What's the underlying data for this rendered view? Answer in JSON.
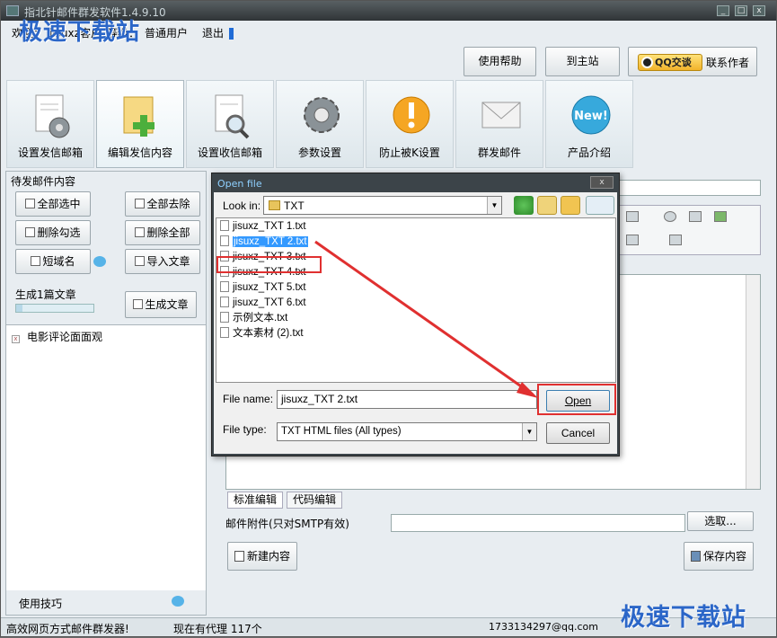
{
  "window": {
    "title": "指北针邮件群发软件1.4.9.10"
  },
  "watermark": {
    "top": "极速下载站",
    "bottom": "极速下载站"
  },
  "userbar": {
    "welcome": "欢迎：",
    "user": "jisuxz客户",
    "role_prefix": "等级：",
    "role": "普通用户",
    "logout": "退出"
  },
  "top_buttons": {
    "help": "使用帮助",
    "home": "到主站",
    "qq_badge": "QQ交谈",
    "contact": "联系作者"
  },
  "tabs": [
    {
      "label": "设置发信邮箱",
      "icon": "document-gear-icon"
    },
    {
      "label": "编辑发信内容",
      "icon": "document-add-icon"
    },
    {
      "label": "设置收信邮箱",
      "icon": "document-search-icon"
    },
    {
      "label": "参数设置",
      "icon": "gear-icon"
    },
    {
      "label": "防止被K设置",
      "icon": "warning-icon"
    },
    {
      "label": "群发邮件",
      "icon": "envelope-icon"
    },
    {
      "label": "产品介绍",
      "icon": "new-badge-icon"
    }
  ],
  "left": {
    "title": "待发邮件内容",
    "select_all": "全部选中",
    "remove_all": "全部去除",
    "delete_checked": "删除勾选",
    "delete_all": "删除全部",
    "short_domain": "短域名",
    "import_article": "导入文章",
    "gen_label": "生成1篇文章",
    "gen_button": "生成文章",
    "progress": 0.08,
    "articles": [
      "电影评论面面观"
    ],
    "tips": "使用技巧"
  },
  "right": {
    "editor_tabs": [
      "标准编辑",
      "代码编辑"
    ],
    "attach_label": "邮件附件(只对SMTP有效)",
    "browse": "选取...",
    "new_content": "新建内容",
    "save_content": "保存内容"
  },
  "statusbar": {
    "left": "高效网页方式邮件群发器!",
    "proxy": "现在有代理 117个",
    "email": "1733134297@qq.com"
  },
  "dialog": {
    "title": "Open file",
    "look_in_label": "Look in:",
    "look_in_value": "TXT",
    "files": [
      "jisuxz_TXT 1.txt",
      "jisuxz_TXT 2.txt",
      "jisuxz_TXT 3.txt",
      "jisuxz_TXT 4.txt",
      "jisuxz_TXT 5.txt",
      "jisuxz_TXT 6.txt",
      "示例文本.txt",
      "文本素材 (2).txt"
    ],
    "selected_index": 1,
    "file_name_label": "File name:",
    "file_name_value": "jisuxz_TXT 2.txt",
    "file_type_label": "File type:",
    "file_type_value": "TXT HTML files (All types)",
    "open": "Open",
    "cancel": "Cancel"
  },
  "colors": {
    "accent": "#2b66c8",
    "highlight": "#e03030",
    "selection": "#3399ff"
  }
}
